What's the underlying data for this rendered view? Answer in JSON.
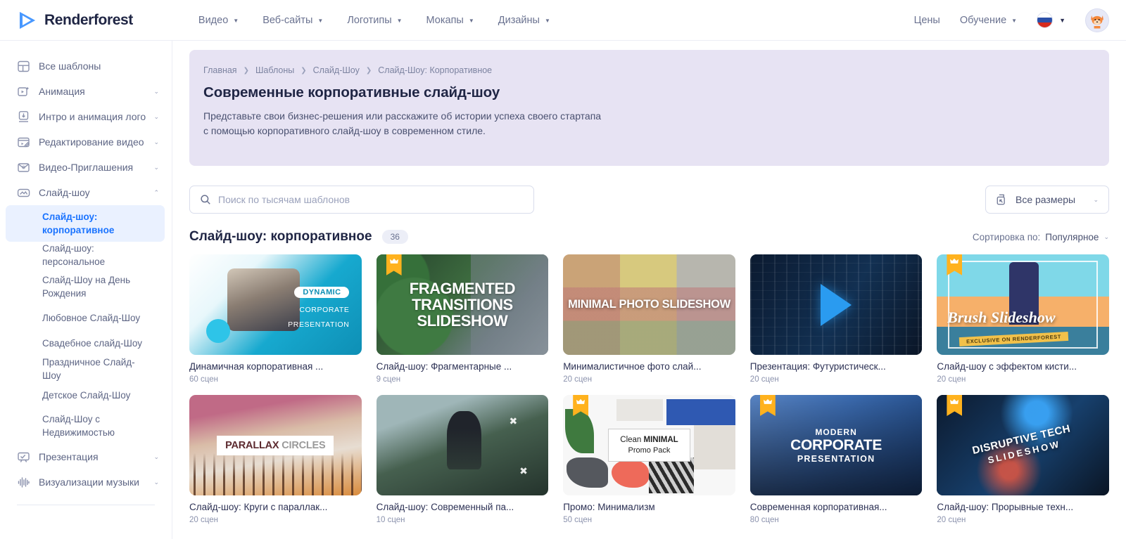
{
  "brand": {
    "name": "Renderforest",
    "logo_icon": "play-triangle-logo"
  },
  "topnav": {
    "items": [
      {
        "label": "Видео",
        "has_caret": true
      },
      {
        "label": "Веб-сайты",
        "has_caret": true
      },
      {
        "label": "Логотипы",
        "has_caret": true
      },
      {
        "label": "Мокапы",
        "has_caret": true
      },
      {
        "label": "Дизайны",
        "has_caret": true
      }
    ],
    "right": {
      "pricing": "Цены",
      "learning": "Обучение",
      "language_flag": "russia-flag-icon",
      "avatar_icon": "fox-avatar"
    }
  },
  "sidebar": {
    "groups": [
      {
        "label": "Все шаблоны",
        "icon": "grid-icon",
        "expandable": false
      },
      {
        "label": "Анимация",
        "icon": "animation-icon",
        "expandable": true,
        "expanded": false
      },
      {
        "label": "Интро и анимация лого",
        "icon": "logo-intro-icon",
        "expandable": true,
        "expanded": false
      },
      {
        "label": "Редактирование видео",
        "icon": "video-edit-icon",
        "expandable": true,
        "expanded": false
      },
      {
        "label": "Видео-Приглашения",
        "icon": "invitation-icon",
        "expandable": true,
        "expanded": false
      },
      {
        "label": "Слайд-шоу",
        "icon": "slideshow-icon",
        "expandable": true,
        "expanded": true
      }
    ],
    "subitems": [
      {
        "label": "Слайд-шоу: корпоративное",
        "active": true
      },
      {
        "label": "Слайд-шоу: персональное",
        "active": false
      },
      {
        "label": "Слайд-Шоу на День Рождения",
        "active": false
      },
      {
        "label": "Любовное Слайд-Шоу",
        "active": false
      },
      {
        "label": "Свадебное слайд-Шоу",
        "active": false
      },
      {
        "label": "Праздничное Слайд-Шоу",
        "active": false
      },
      {
        "label": "Детское Слайд-Шоу",
        "active": false
      },
      {
        "label": "Слайд-Шоу с Недвижимостью",
        "active": false
      }
    ],
    "groups_after": [
      {
        "label": "Презентация",
        "icon": "presentation-icon",
        "expandable": true
      },
      {
        "label": "Визуализации музыки",
        "icon": "music-wave-icon",
        "expandable": true
      }
    ]
  },
  "hero": {
    "breadcrumbs": [
      "Главная",
      "Шаблоны",
      "Слайд-Шоу",
      "Слайд-Шоу: Корпоративное"
    ],
    "title": "Современные корпоративные слайд-шоу",
    "subtitle_line1": "Представьте свои бизнес-решения или расскажите об истории успеха своего стартапа",
    "subtitle_line2": "с помощью корпоративного слайд-шоу в современном стиле.",
    "bg_color": "#e7e3f3"
  },
  "search": {
    "placeholder": "Поиск по тысячам шаблонов",
    "value": "",
    "icon": "search-icon"
  },
  "size_filter": {
    "label": "Все размеры",
    "icon": "resize-icon",
    "caret": "chevron-down-icon"
  },
  "results": {
    "title": "Слайд-шоу: корпоративное",
    "count": "36",
    "sort_label": "Сортировка по:",
    "sort_value": "Популярное"
  },
  "cards": [
    {
      "title": "Динамичная корпоративная ...",
      "scenes": "60 сцен",
      "premium": false,
      "art": "t1",
      "art_text": {
        "pill": "DYNAMIC",
        "l2": "CORPORATE",
        "l3": "PRESENTATION"
      }
    },
    {
      "title": "Слайд-шоу: Фрагментарные ...",
      "scenes": "9 сцен",
      "premium": true,
      "art": "t2",
      "art_text": {
        "line1": "FRAGMENTED",
        "line2": "TRANSITIONS",
        "line3": "SLIDESHOW"
      }
    },
    {
      "title": "Минималистичное фото слай...",
      "scenes": "20 сцен",
      "premium": false,
      "art": "t3",
      "art_text": {
        "line1": "MINIMAL PHOTO SLIDESHOW"
      }
    },
    {
      "title": "Презентация: Футуристическ...",
      "scenes": "20 сцен",
      "premium": false,
      "art": "t4",
      "art_text": {}
    },
    {
      "title": "Слайд-шоу с эффектом кисти...",
      "scenes": "20 сцен",
      "premium": true,
      "art": "t5",
      "art_text": {
        "line1": "Brush Slideshow",
        "ribbon": "EXCLUSIVE ON RENDERFOREST"
      }
    },
    {
      "title": "Слайд-шоу: Круги с параллак...",
      "scenes": "20 сцен",
      "premium": false,
      "art": "t6",
      "art_text": {
        "b1": "PARALLAX",
        "b2": "CIRCLES"
      }
    },
    {
      "title": "Слайд-шоу: Современный па...",
      "scenes": "10 сцен",
      "premium": false,
      "art": "t7",
      "art_text": {}
    },
    {
      "title": "Промо: Минимализм",
      "scenes": "50 сцен",
      "premium": true,
      "art": "t8",
      "art_text": {
        "l1a": "Clean ",
        "l1b": "MINIMAL",
        "l2": "Promo Pack"
      }
    },
    {
      "title": "Современная корпоративная...",
      "scenes": "80 сцен",
      "premium": true,
      "art": "t9",
      "art_text": {
        "m1": "MODERN",
        "m2": "CORPORATE",
        "m3": "PRESENTATION"
      }
    },
    {
      "title": "Слайд-шоу: Прорывные техн...",
      "scenes": "20 сцен",
      "premium": true,
      "art": "t10",
      "art_text": {
        "d1": "DISRUPTIVE TECH",
        "d2": "SLIDESHOW"
      }
    }
  ]
}
